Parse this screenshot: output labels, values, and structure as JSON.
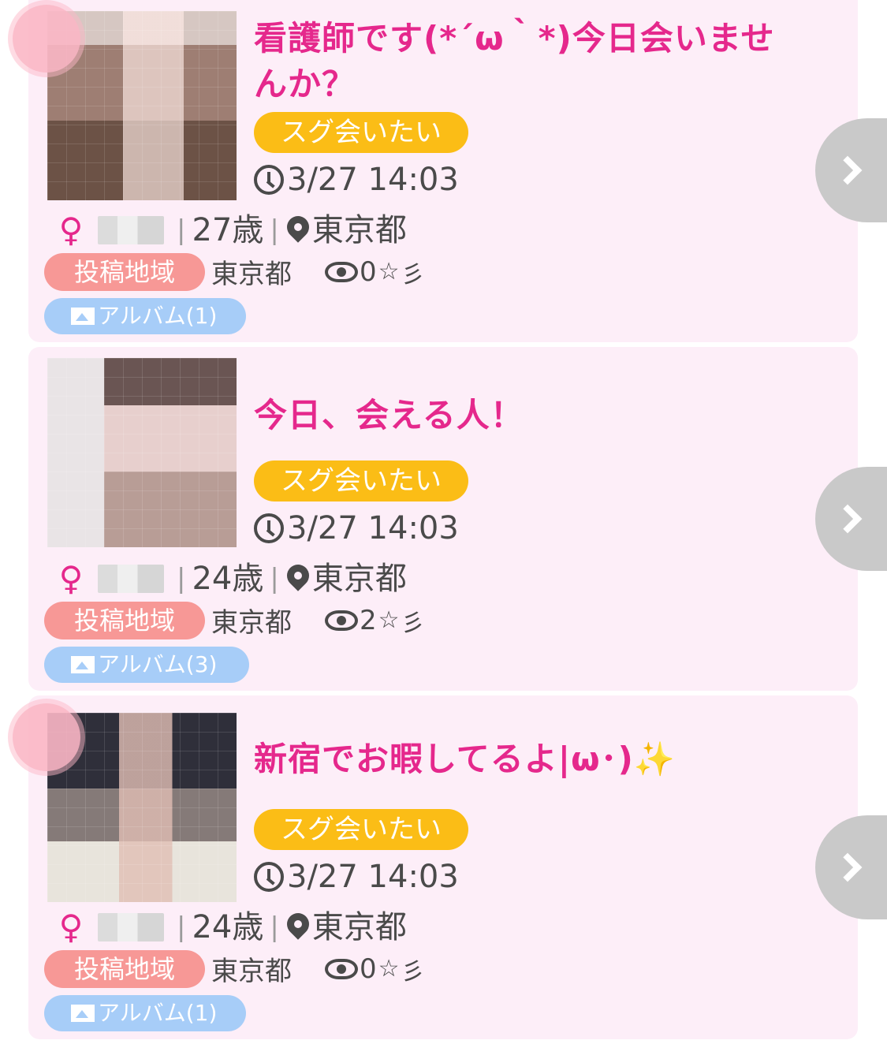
{
  "posts": [
    {
      "title": "看護師です(*´ω｀*)今日会いませんか？",
      "tag": "スグ会いたい",
      "time": "3/27 14:03",
      "gender": "♀",
      "age": "27歳",
      "location": "東京都",
      "area_label": "投稿地域",
      "area": "東京都",
      "views": "0",
      "fav": "☆",
      "extra": "彡",
      "album": "アルバム(1)"
    },
    {
      "title": "今日、会える人！",
      "tag": "スグ会いたい",
      "time": "3/27 14:03",
      "gender": "♀",
      "age": "24歳",
      "location": "東京都",
      "area_label": "投稿地域",
      "area": "東京都",
      "views": "2",
      "fav": "☆",
      "extra": "彡",
      "album": "アルバム(3)"
    },
    {
      "title": "新宿でお暇してるよ|ω･)✨",
      "tag": "スグ会いたい",
      "time": "3/27 14:03",
      "gender": "♀",
      "age": "24歳",
      "location": "東京都",
      "area_label": "投稿地域",
      "area": "東京都",
      "views": "0",
      "fav": "☆",
      "extra": "彡",
      "album": "アルバム(1)"
    }
  ],
  "colors": {
    "card_bg": "#fdeef8",
    "title": "#e5288c",
    "tag_bg": "#fbbd16",
    "area_tag_bg": "#f79896",
    "album_bg": "#a7cdf8",
    "next_bg": "#c9c9c9"
  }
}
